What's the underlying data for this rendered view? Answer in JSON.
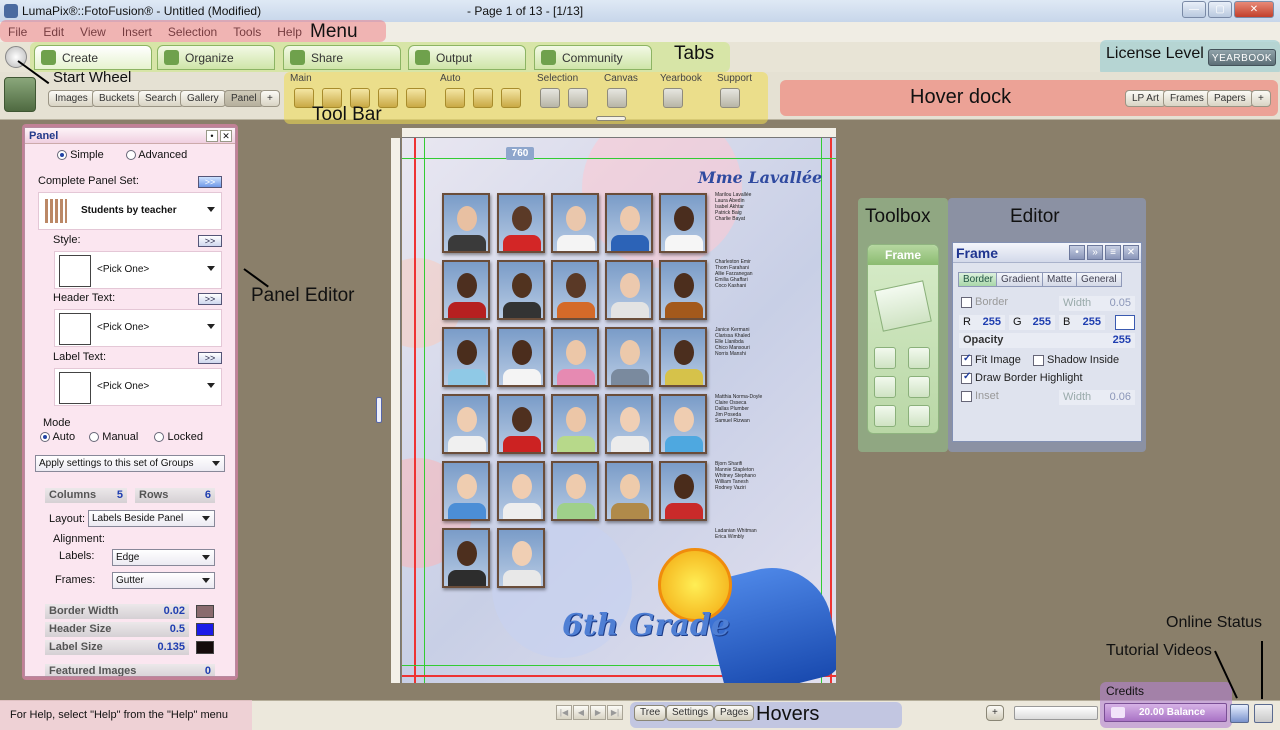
{
  "window": {
    "title": "LumaPix®::FotoFusion® - Untitled (Modified)",
    "page_status": "- Page 1 of 13 - [1/13]",
    "controls": [
      "—",
      "▢",
      "✕"
    ]
  },
  "menu": {
    "items": [
      "File",
      "Edit",
      "View",
      "Insert",
      "Selection",
      "Tools",
      "Help"
    ]
  },
  "tabs": [
    {
      "label": "Create",
      "icon": "create-icon"
    },
    {
      "label": "Organize",
      "icon": "organize-icon"
    },
    {
      "label": "Share",
      "icon": "share-icon"
    },
    {
      "label": "Output",
      "icon": "output-icon"
    },
    {
      "label": "Community",
      "icon": "community-icon"
    }
  ],
  "license": {
    "badge": "YEARBOOK"
  },
  "toolbar": {
    "left_buttons": [
      "Images",
      "Buckets",
      "Search",
      "Gallery",
      "Panel",
      "+"
    ],
    "groups": [
      "Main",
      "Auto",
      "Selection",
      "Canvas",
      "Yearbook",
      "Support"
    ]
  },
  "hover_dock": {
    "buttons": [
      "LP Art",
      "Frames",
      "Papers",
      "+"
    ]
  },
  "callouts": {
    "menu": "Menu",
    "tabs": "Tabs",
    "license": "License Level",
    "start_wheel": "Start Wheel",
    "toolbar": "Tool Bar",
    "hover_dock": "Hover dock",
    "panel_editor": "Panel Editor",
    "toolbox": "Toolbox",
    "editor": "Editor",
    "hovers": "Hovers",
    "online_status": "Online Status",
    "tutorial_videos": "Tutorial Videos"
  },
  "panel": {
    "title": "Panel",
    "mode_simple": "Simple",
    "mode_advanced": "Advanced",
    "complete_set_label": "Complete Panel Set:",
    "complete_set_value": "Students by teacher",
    "style_label": "Style:",
    "style_value": "<Pick One>",
    "header_text_label": "Header Text:",
    "header_text_value": "<Pick One>",
    "label_text_label": "Label Text:",
    "label_text_value": "<Pick One>",
    "expand_label": ">>",
    "mode_label": "Mode",
    "modes": [
      "Auto",
      "Manual",
      "Locked"
    ],
    "apply_value": "Apply settings to this set of Groups",
    "columns_label": "Columns",
    "columns_value": "5",
    "rows_label": "Rows",
    "rows_value": "6",
    "layout_label": "Layout:",
    "layout_value": "Labels Beside Panel",
    "alignment_label": "Alignment:",
    "labels_label": "Labels:",
    "labels_value": "Edge",
    "frames_label": "Frames:",
    "frames_value": "Gutter",
    "border_width_label": "Border Width",
    "border_width_value": "0.02",
    "header_size_label": "Header Size",
    "header_size_value": "0.5",
    "label_size_label": "Label Size",
    "label_size_value": "0.135",
    "featured_label": "Featured Images",
    "featured_value": "0"
  },
  "page": {
    "tag": "760",
    "teacher": "Mme Lavallée",
    "grade": "6th Grade",
    "name_groups": [
      [
        "Marilou Lavallée",
        "Laura Abedin",
        "Isabel Akhtar",
        "Patrick Baig",
        "Charlie Bayat"
      ],
      [
        "Charleston Emir",
        "Thom Farahani",
        "Allie Farzanegan",
        "Emilia Ghaffari",
        "Coco Kashani"
      ],
      [
        "Janice Kermani",
        "Clarissa Khaled",
        "Elle Llanibda",
        "Chico Mansouri",
        "Norris Manshi"
      ],
      [
        "Matthia Norma-Doyle",
        "Claire Osseca",
        "Dallas Plumber",
        "Jim Poseda",
        "Samuel Rizwan"
      ],
      [
        "Bjorn Sharifi",
        "Mannie Stapleton",
        "Whitney Stephano",
        "William Tanesh",
        "Rodney Vaziri"
      ],
      [
        "Ladanian Whitman",
        "Erica Wimbly"
      ]
    ]
  },
  "toolbox": {
    "title": "Frame"
  },
  "editor": {
    "title": "Frame",
    "tabs": [
      "Border",
      "Gradient",
      "Matte",
      "General"
    ],
    "border_label": "Border",
    "width_label": "Width",
    "width_value": "0.05",
    "r_label": "R",
    "r_value": "255",
    "g_label": "G",
    "g_value": "255",
    "b_label": "B",
    "b_value": "255",
    "opacity_label": "Opacity",
    "opacity_value": "255",
    "fit_image_label": "Fit Image",
    "shadow_inside_label": "Shadow Inside",
    "draw_border_label": "Draw Border Highlight",
    "inset_label": "Inset",
    "inset_width_label": "Width",
    "inset_width_value": "0.06"
  },
  "status": {
    "help_text": "For Help, select \"Help\" from the \"Help\" menu",
    "nav": [
      "|◀",
      "◀",
      "▶",
      "▶|"
    ],
    "hover_buttons": [
      "Tree",
      "Settings",
      "Pages"
    ],
    "plus": "+",
    "credits_label": "Credits",
    "balance": "20.00 Balance"
  },
  "colors": {
    "menu_highlight": "#f06e78",
    "tabs_highlight": "#c8e682",
    "toolbar_highlight": "#f0dc50",
    "hover_dock_highlight": "#f07868",
    "panel_highlight": "#e682b4",
    "editor_title": "#1f3590",
    "value_blue": "#1f3eb0"
  }
}
